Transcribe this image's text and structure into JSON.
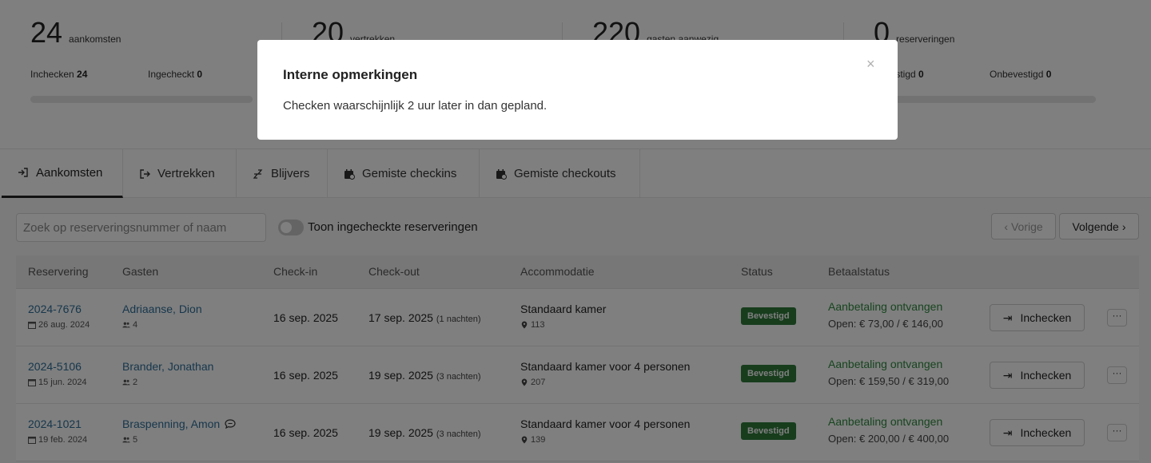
{
  "stats": [
    {
      "value": "24",
      "unit": "aankomsten",
      "subs": [
        {
          "label": "Inchecken",
          "value": "24"
        },
        {
          "label": "Ingecheckt",
          "value": "0"
        }
      ]
    },
    {
      "value": "20",
      "unit": "vertrekken",
      "subs": []
    },
    {
      "value": "220",
      "unit": "gasten aanwezig",
      "subs": []
    },
    {
      "value": "0",
      "unit": "reserveringen",
      "subs": [
        {
          "label": "Bevestigd",
          "value": "0"
        },
        {
          "label": "Onbevestigd",
          "value": "0"
        }
      ]
    }
  ],
  "tabs": [
    {
      "label": "Aankomsten",
      "icon": "arrival-icon",
      "active": true
    },
    {
      "label": "Vertrekken",
      "icon": "departure-icon"
    },
    {
      "label": "Blijvers",
      "icon": "sleep-icon"
    },
    {
      "label": "Gemiste checkins",
      "icon": "calendar-alert-icon"
    },
    {
      "label": "Gemiste checkouts",
      "icon": "calendar-alert-icon"
    }
  ],
  "search": {
    "placeholder": "Zoek op reserveringsnummer of naam"
  },
  "toggle": {
    "label": "Toon ingecheckte reserveringen",
    "on": false
  },
  "pagination": {
    "prev": "Vorige",
    "next": "Volgende"
  },
  "table": {
    "headers": [
      "Reservering",
      "Gasten",
      "Check-in",
      "Check-out",
      "Accommodatie",
      "Status",
      "Betaalstatus"
    ],
    "rows": [
      {
        "id": "2024-7676",
        "created": "26 aug. 2024",
        "guest": "Adriaanse, Dion",
        "guests_count": "4",
        "has_comment": false,
        "checkin": "16 sep. 2025",
        "checkout": "17 sep. 2025",
        "nights": "(1 nachten)",
        "accommodation": "Standaard kamer",
        "room": "113",
        "status": "Bevestigd",
        "payment": "Aanbetaling ontvangen",
        "open": "Open: € 73,00 / € 146,00",
        "action": "Inchecken"
      },
      {
        "id": "2024-5106",
        "created": "15 jun. 2024",
        "guest": "Brander, Jonathan",
        "guests_count": "2",
        "has_comment": false,
        "checkin": "16 sep. 2025",
        "checkout": "19 sep. 2025",
        "nights": "(3 nachten)",
        "accommodation": "Standaard kamer voor 4 personen",
        "room": "207",
        "status": "Bevestigd",
        "payment": "Aanbetaling ontvangen",
        "open": "Open: € 159,50 / € 319,00",
        "action": "Inchecken"
      },
      {
        "id": "2024-1021",
        "created": "19 feb. 2024",
        "guest": "Braspenning, Amon",
        "guests_count": "5",
        "has_comment": true,
        "checkin": "16 sep. 2025",
        "checkout": "19 sep. 2025",
        "nights": "(3 nachten)",
        "accommodation": "Standaard kamer voor 4 personen",
        "room": "139",
        "status": "Bevestigd",
        "payment": "Aanbetaling ontvangen",
        "open": "Open: € 200,00 / € 400,00",
        "action": "Inchecken"
      }
    ]
  },
  "modal": {
    "title": "Interne opmerkingen",
    "body": "Checken waarschijnlijk 2 uur later in dan gepland.",
    "close": "×"
  },
  "more_label": "···",
  "colors": {
    "status_green": "#2f7a3b",
    "payment_green": "#2e8a3e",
    "link_blue": "#2f6f98"
  }
}
